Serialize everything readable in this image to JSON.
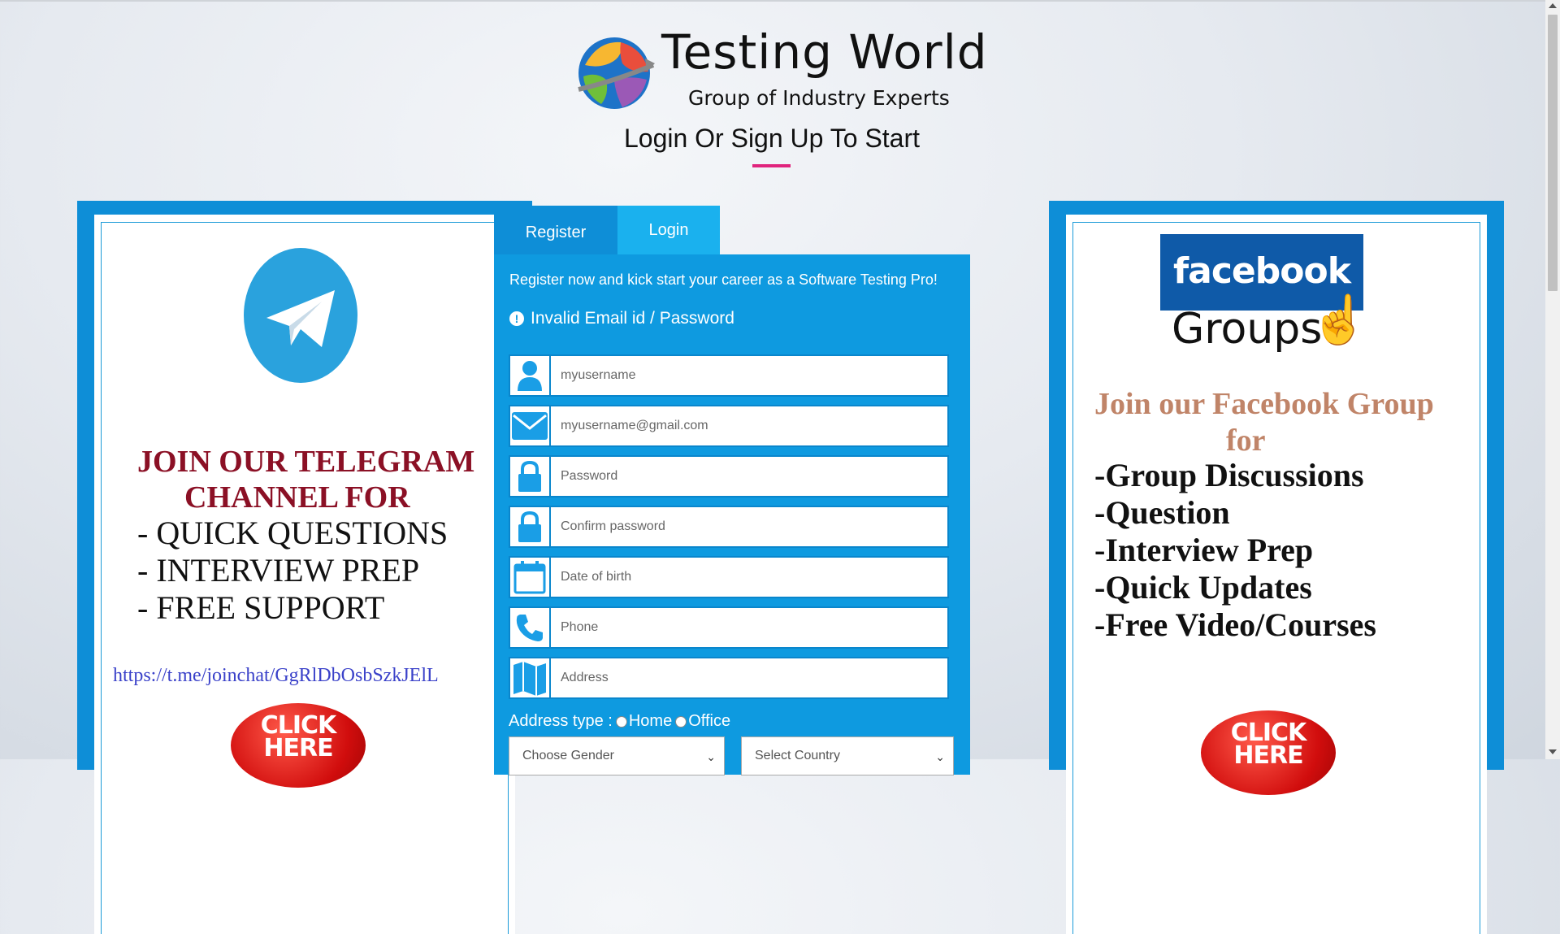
{
  "header": {
    "brand_title": "Testing World",
    "brand_subtitle": "Group of Industry Experts",
    "page_title": "Login Or Sign Up To Start"
  },
  "telegram_panel": {
    "heading_line1": "JOIN OUR TELEGRAM",
    "heading_line2": "CHANNEL  FOR",
    "items": [
      "- QUICK QUESTIONS",
      "- INTERVIEW PREP",
      "- FREE SUPPORT"
    ],
    "link": "https://t.me/joinchat/GgRlDbOsbSzkJElL",
    "cta": "CLICK HERE"
  },
  "facebook_panel": {
    "logo_text": "facebook",
    "groups_text": "Groups",
    "heading": "Join our Facebook Group",
    "heading_for": "for",
    "items": [
      "-Group Discussions",
      "-Question",
      "-Interview Prep",
      "-Quick Updates",
      "-Free Video/Courses"
    ],
    "cta": "CLICK HERE"
  },
  "tabs": {
    "register": "Register",
    "login": "Login"
  },
  "form": {
    "intro": "Register now and kick start your career as a Software Testing Pro!",
    "error": "Invalid Email id / Password",
    "fields": [
      {
        "icon": "user-icon",
        "placeholder": "myusername",
        "value": ""
      },
      {
        "icon": "envelope-icon",
        "placeholder": "myusername@gmail.com",
        "value": ""
      },
      {
        "icon": "lock-icon",
        "placeholder": "Password",
        "value": ""
      },
      {
        "icon": "lock-icon",
        "placeholder": "Confirm password",
        "value": ""
      },
      {
        "icon": "calendar-icon",
        "placeholder": "Date of birth",
        "value": ""
      },
      {
        "icon": "phone-icon",
        "placeholder": "Phone",
        "value": ""
      },
      {
        "icon": "map-icon",
        "placeholder": "Address",
        "value": ""
      }
    ],
    "address_type_label": "Address type :",
    "address_options": [
      "Home",
      "Office"
    ],
    "gender_select": "Choose Gender",
    "country_select": "Select Country"
  },
  "colors": {
    "panel_blue": "#0e8ed7",
    "tab_active": "#1ab1ee",
    "accent_pink": "#e0247d",
    "telegram_red": "#8b1025",
    "facebook_brown": "#c08468"
  }
}
